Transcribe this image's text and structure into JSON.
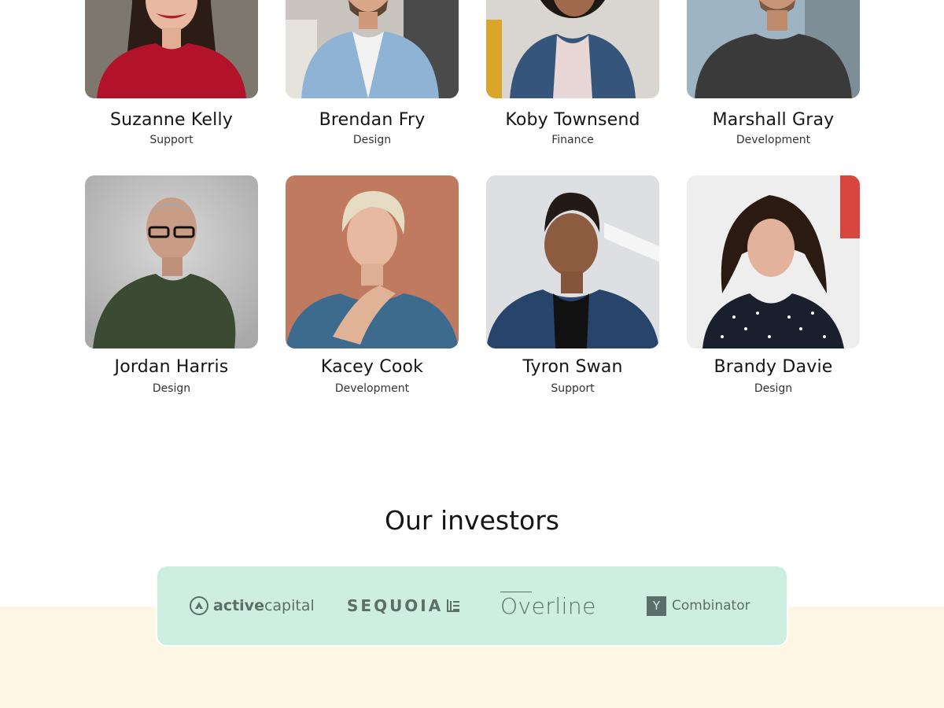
{
  "team": [
    {
      "name": "Suzanne Kelly",
      "role": "Support",
      "photo": "woman-red-sweater-photo"
    },
    {
      "name": "Brendan Fry",
      "role": "Design",
      "photo": "man-denim-shirt-photo"
    },
    {
      "name": "Koby Townsend",
      "role": "Finance",
      "photo": "woman-curly-hair-jacket-photo"
    },
    {
      "name": "Marshall Gray",
      "role": "Development",
      "photo": "man-dark-tshirt-photo"
    },
    {
      "name": "Jordan Harris",
      "role": "Design",
      "photo": "man-glasses-polo-photo"
    },
    {
      "name": "Kacey Cook",
      "role": "Development",
      "photo": "person-blonde-hair-photo"
    },
    {
      "name": "Tyron Swan",
      "role": "Support",
      "photo": "man-blue-shirt-photo"
    },
    {
      "name": "Brandy Davie",
      "role": "Design",
      "photo": "woman-polka-dot-photo"
    }
  ],
  "investors": {
    "title": "Our investors",
    "logos": {
      "active_a": "active",
      "active_b": "capital",
      "sequoia": "SEQUOIA",
      "overline": "Overline",
      "yc_box": "Y",
      "yc_text": "Combinator"
    }
  },
  "colors": {
    "logo_strip_bg": "#cfeee2",
    "logo_ink": "#5b6e69",
    "footer_band": "#fdf6e3"
  }
}
